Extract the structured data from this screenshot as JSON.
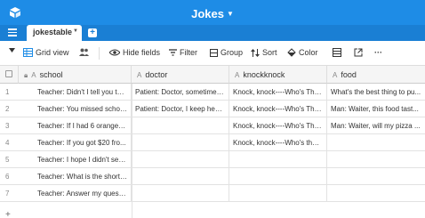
{
  "app": {
    "title": "Jokes",
    "accent_color": "#1e8ce6"
  },
  "tabs": {
    "active_table": "jokestable"
  },
  "toolbar": {
    "view_name": "Grid view",
    "hide_fields": "Hide fields",
    "filter": "Filter",
    "group": "Group",
    "sort": "Sort",
    "color": "Color",
    "icons": [
      "collapse-caret-icon",
      "grid-view-icon",
      "view-share-icon",
      "hide-fields-icon",
      "filter-icon",
      "group-icon",
      "sort-icon",
      "color-icon",
      "row-height-icon",
      "share-icon",
      "more-icon"
    ]
  },
  "table": {
    "columns": [
      {
        "name": "school"
      },
      {
        "name": "doctor"
      },
      {
        "name": "knockknock"
      },
      {
        "name": "food"
      }
    ],
    "rows": [
      {
        "num": "1",
        "school": "Teacher: Didn't I tell you to ...",
        "doctor": "Patient: Doctor, sometimes...",
        "knockknock": "Knock, knock----Who's The...",
        "food": "What's the best thing to pu..."
      },
      {
        "num": "2",
        "school": "Teacher: You missed schoo...",
        "doctor": "Patient: Doctor, I keep hear...",
        "knockknock": "Knock, knock----Who's The...",
        "food": "Man: Waiter, this food tast..."
      },
      {
        "num": "3",
        "school": "Teacher: If I had 6 oranges ...",
        "doctor": "",
        "knockknock": "Knock, knock----Who's The...",
        "food": "Man: Waiter, will my pizza ..."
      },
      {
        "num": "4",
        "school": "Teacher: If you got $20 fro...",
        "doctor": "",
        "knockknock": "Knock, knock----Who's ther...",
        "food": ""
      },
      {
        "num": "5",
        "school": "Teacher: I hope I didn't see...",
        "doctor": "",
        "knockknock": "",
        "food": ""
      },
      {
        "num": "6",
        "school": "Teacher: What is the shorte...",
        "doctor": "",
        "knockknock": "",
        "food": ""
      },
      {
        "num": "7",
        "school": "Teacher: Answer my questi...",
        "doctor": "",
        "knockknock": "",
        "food": ""
      }
    ],
    "add_row": "+"
  }
}
